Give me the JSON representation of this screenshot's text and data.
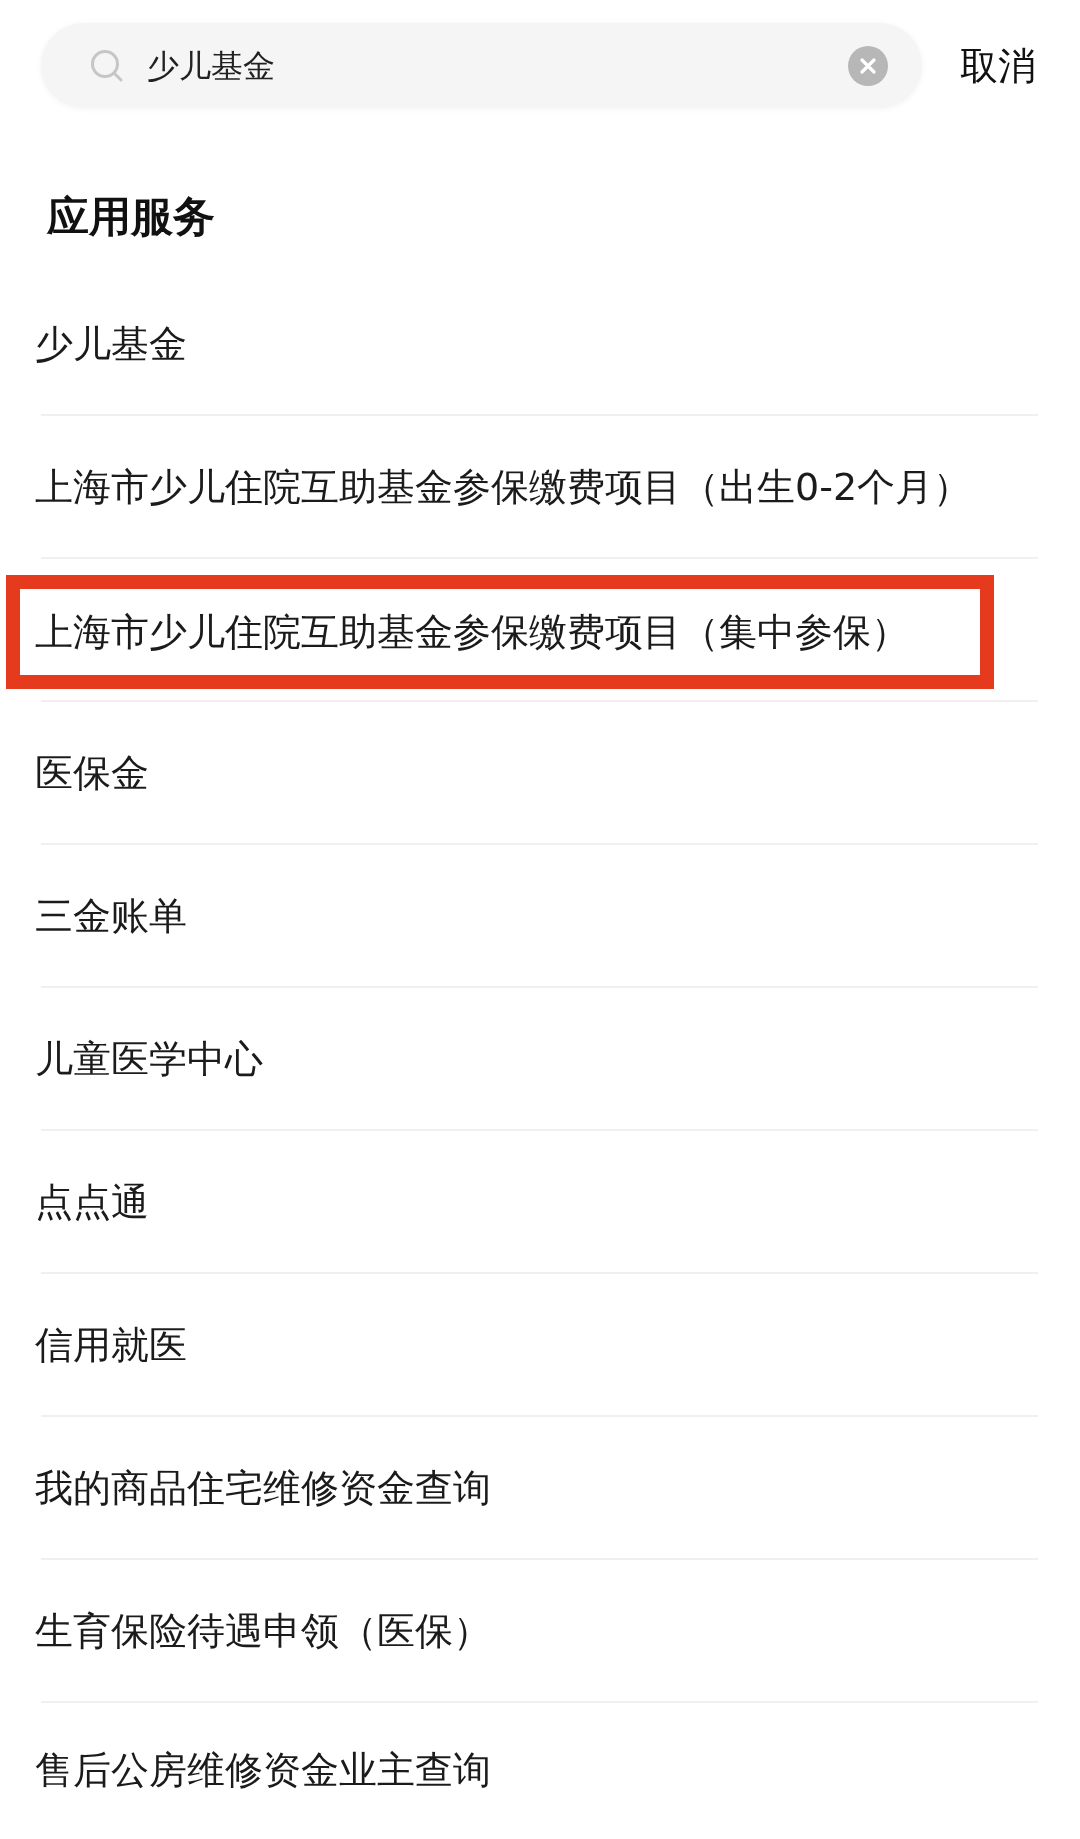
{
  "search": {
    "value": "少儿基金",
    "cancel": "取消"
  },
  "section": {
    "title": "应用服务"
  },
  "results": [
    {
      "label": "少儿基金",
      "highlighted": false
    },
    {
      "label": "上海市少儿住院互助基金参保缴费项目（出生0-2个月）",
      "highlighted": false
    },
    {
      "label": "上海市少儿住院互助基金参保缴费项目（集中参保）",
      "highlighted": true
    },
    {
      "label": "医保金",
      "highlighted": false
    },
    {
      "label": "三金账单",
      "highlighted": false
    },
    {
      "label": "儿童医学中心",
      "highlighted": false
    },
    {
      "label": "点点通",
      "highlighted": false
    },
    {
      "label": "信用就医",
      "highlighted": false
    },
    {
      "label": "我的商品住宅维修资金查询",
      "highlighted": false
    },
    {
      "label": "生育保险待遇申领（医保）",
      "highlighted": false
    },
    {
      "label": "售后公房维修资金业主查询",
      "highlighted": false
    }
  ]
}
